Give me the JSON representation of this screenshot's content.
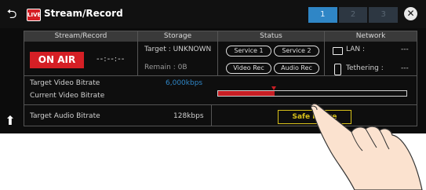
{
  "header": {
    "back_icon": "return-arrow-icon",
    "live_badge": "LIVE",
    "title": "Stream/Record",
    "pages": [
      "1",
      "2",
      "3"
    ],
    "active_page": "1",
    "close_icon": "close-x-icon"
  },
  "columns": {
    "stream_record": "Stream/Record",
    "storage": "Storage",
    "status": "Status",
    "network": "Network"
  },
  "stream_record": {
    "on_air_label": "ON AIR",
    "rec_time": "--:--:--"
  },
  "storage": {
    "target": "Target : UNKNOWN",
    "remain": "Remain : 0B"
  },
  "status": {
    "service1": "Service 1",
    "service2": "Service 2",
    "video_rec": "Video Rec",
    "audio_rec": "Audio Rec"
  },
  "network": {
    "lan_label": "LAN :",
    "lan_value": "---",
    "tethering_label": "Tethering :",
    "tethering_value": "---",
    "lan_icon": "monitor-icon",
    "tethering_icon": "phone-icon"
  },
  "bitrate": {
    "target_video_label": "Target Video Bitrate",
    "target_video_value": "6,000kbps",
    "current_video_label": "Current Video Bitrate",
    "current_fraction": 0.3,
    "target_fraction": 0.3,
    "target_audio_label": "Target Audio Bitrate",
    "target_audio_value": "128kbps"
  },
  "buttons": {
    "safe_image": "Safe Image"
  },
  "colors": {
    "accent_blue": "#2f86c6",
    "on_air_red": "#d51f25",
    "highlight_yellow": "#d8c11a"
  },
  "icons": {
    "scroll_up": "up-arrow-icon",
    "pointer_hand": "pointing-hand"
  }
}
